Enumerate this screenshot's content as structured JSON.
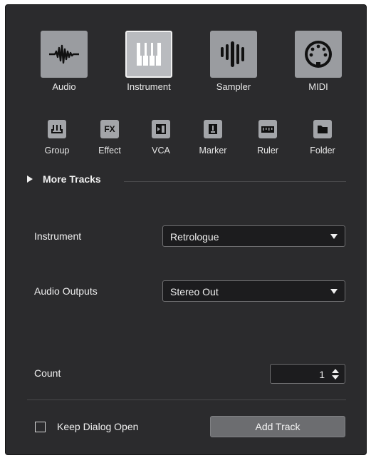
{
  "track_types": [
    {
      "label": "Audio",
      "icon": "waveform-icon",
      "selected": false
    },
    {
      "label": "Instrument",
      "icon": "piano-keys-icon",
      "selected": true
    },
    {
      "label": "Sampler",
      "icon": "sampler-bars-icon",
      "selected": false
    },
    {
      "label": "MIDI",
      "icon": "midi-connector-icon",
      "selected": false
    }
  ],
  "small_types": [
    {
      "label": "Group",
      "icon": "group-icon",
      "glyph": "ш"
    },
    {
      "label": "Effect",
      "icon": "fx-icon",
      "glyph": "FX"
    },
    {
      "label": "VCA",
      "icon": "vca-icon",
      "glyph": ""
    },
    {
      "label": "Marker",
      "icon": "marker-icon",
      "glyph": ""
    },
    {
      "label": "Ruler",
      "icon": "ruler-icon",
      "glyph": ""
    },
    {
      "label": "Folder",
      "icon": "folder-icon",
      "glyph": ""
    }
  ],
  "more_tracks": {
    "label": "More Tracks"
  },
  "instrument": {
    "label": "Instrument",
    "value": "Retrologue"
  },
  "audio_outputs": {
    "label": "Audio Outputs",
    "value": "Stereo Out"
  },
  "count": {
    "label": "Count",
    "value": "1"
  },
  "keep_dialog_open": {
    "label": "Keep Dialog Open",
    "checked": false
  },
  "add_track": {
    "label": "Add Track"
  },
  "colors": {
    "panel_bg": "#2b2b2d",
    "tile": "#9a9ca0",
    "field_bg": "#1c1c1e",
    "button": "#6c6d70"
  }
}
